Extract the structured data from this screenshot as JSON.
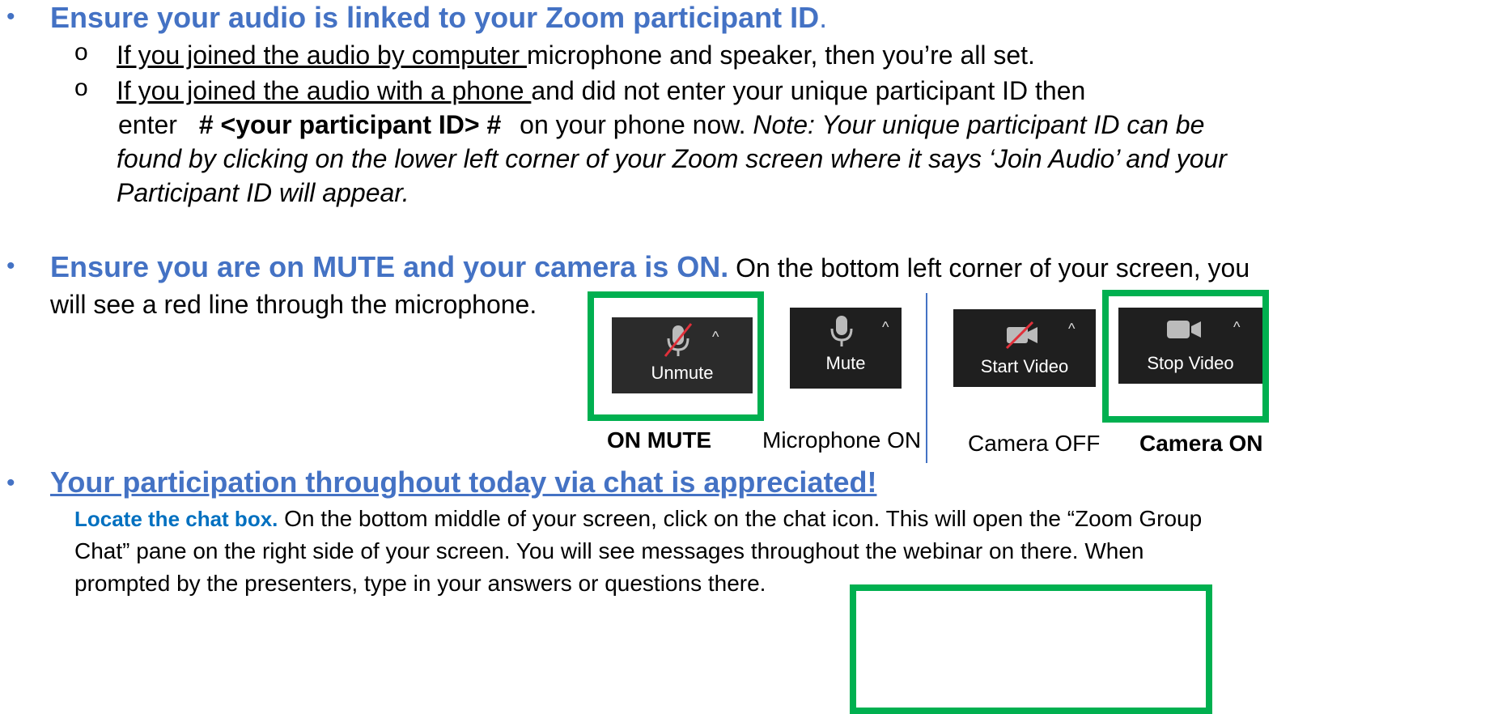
{
  "section1": {
    "heading": "Ensure your audio is linked to your Zoom participant ID",
    "heading_period": ".",
    "sub1_underlined": "If you joined the audio by computer ",
    "sub1_rest": "microphone and speaker, then you’re all set.",
    "sub2_underlined": "If you joined the audio with a phone ",
    "sub2_rest": "and did not enter your unique participant ID then",
    "sub2_enter": "enter",
    "sub2_code": "# <your participant ID> #",
    "sub2_after_code": "on your phone now. ",
    "sub2_note_line1": "Note: Your unique participant ID can be",
    "sub2_note_line2": "found by clicking on the lower left corner of your Zoom screen where it says ‘Join Audio’ and your",
    "sub2_note_line3": "Participant ID will appear."
  },
  "section2": {
    "heading": "Ensure you are on MUTE and your camera is ON.",
    "text_line1": " On the bottom left corner of your screen, you",
    "text_line2": "will see a red line through the microphone.",
    "buttons": {
      "unmute_label": "Unmute",
      "mute_label": "Mute",
      "start_video_label": "Start Video",
      "stop_video_label": "Stop Video"
    },
    "captions": {
      "on_mute": "ON MUTE",
      "microphone_on": "Microphone ON",
      "camera_off": "Camera OFF",
      "camera_on": "Camera ON"
    }
  },
  "section3": {
    "heading": "Your participation throughout today via chat is appreciated!",
    "locate_label": "Locate the chat box.",
    "line1_rest": " On the bottom middle of your screen, click on the chat icon. This will open the “Zoom Group",
    "line2": "Chat” pane on the right side of your screen. You will see messages throughout the webinar on there. When",
    "line3": "prompted by the presenters, type in your answers or questions there."
  },
  "colors": {
    "heading_blue": "#4472c4",
    "locate_blue": "#0070c0",
    "highlight_green": "#00b050",
    "zoom_button_bg": "#1f1f1f",
    "mic_slash_red": "#e0303a"
  }
}
